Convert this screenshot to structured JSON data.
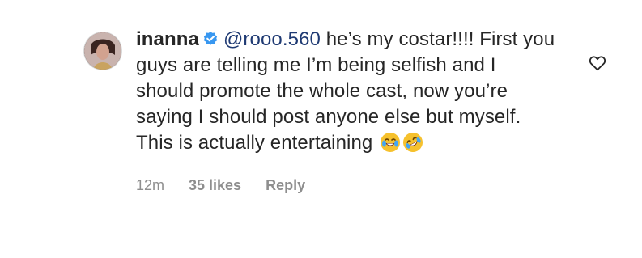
{
  "comment": {
    "username": "inanna",
    "mention": "@rooo.560",
    "text_after_mention": " he’s my costar!!!! First you guys are telling me I’m being selfish and I should promote the whole cast, now you’re saying I should post anyone else but myself. This is actually entertaining ",
    "emojis": [
      "face-with-tears-of-joy-icon",
      "rolling-on-floor-laughing-icon"
    ],
    "time": "12m",
    "likes": "35 likes",
    "reply_label": "Reply"
  },
  "icons": {
    "verified": "verified-badge-icon",
    "like": "heart-outline-icon"
  },
  "colors": {
    "text": "#262626",
    "muted": "#8e8e8e",
    "mention": "#1f3a73",
    "verified": "#3897f0"
  }
}
